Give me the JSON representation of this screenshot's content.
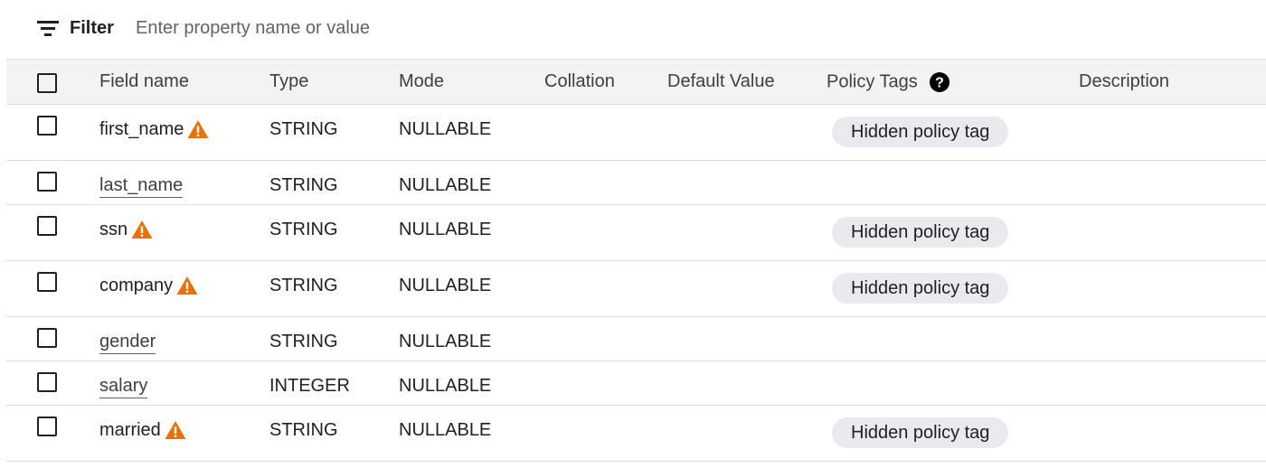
{
  "filter": {
    "label": "Filter",
    "placeholder": "Enter property name or value",
    "value": ""
  },
  "table": {
    "headers": {
      "field_name": "Field name",
      "type": "Type",
      "mode": "Mode",
      "collation": "Collation",
      "default_value": "Default Value",
      "policy_tags": "Policy Tags",
      "description": "Description"
    },
    "rows": [
      {
        "name": "first_name",
        "warning": true,
        "type": "STRING",
        "mode": "NULLABLE",
        "collation": "",
        "default_value": "",
        "policy_tag": "Hidden policy tag",
        "description": ""
      },
      {
        "name": "last_name",
        "warning": false,
        "type": "STRING",
        "mode": "NULLABLE",
        "collation": "",
        "default_value": "",
        "policy_tag": "",
        "description": ""
      },
      {
        "name": "ssn",
        "warning": true,
        "type": "STRING",
        "mode": "NULLABLE",
        "collation": "",
        "default_value": "",
        "policy_tag": "Hidden policy tag",
        "description": ""
      },
      {
        "name": "company",
        "warning": true,
        "type": "STRING",
        "mode": "NULLABLE",
        "collation": "",
        "default_value": "",
        "policy_tag": "Hidden policy tag",
        "description": ""
      },
      {
        "name": "gender",
        "warning": false,
        "type": "STRING",
        "mode": "NULLABLE",
        "collation": "",
        "default_value": "",
        "policy_tag": "",
        "description": ""
      },
      {
        "name": "salary",
        "warning": false,
        "type": "INTEGER",
        "mode": "NULLABLE",
        "collation": "",
        "default_value": "",
        "policy_tag": "",
        "description": ""
      },
      {
        "name": "married",
        "warning": true,
        "type": "STRING",
        "mode": "NULLABLE",
        "collation": "",
        "default_value": "",
        "policy_tag": "Hidden policy tag",
        "description": ""
      }
    ]
  },
  "icons": {
    "filter": "filter-list-icon",
    "warning": "warning-triangle-icon",
    "help": "help-circle-icon"
  },
  "colors": {
    "warning": "#e8710a",
    "header_bg": "#f1f3f4",
    "chip_bg": "#e8eaed",
    "border": "#dadce0"
  }
}
